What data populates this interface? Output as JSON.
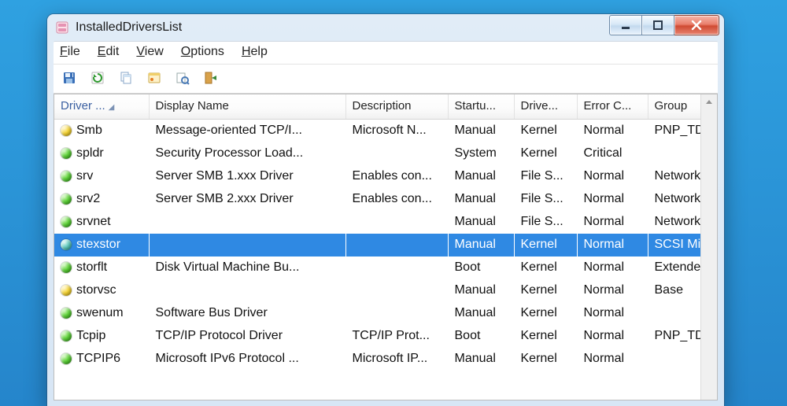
{
  "window": {
    "title": "InstalledDriversList"
  },
  "menu": {
    "file": "File",
    "edit": "Edit",
    "view": "View",
    "options": "Options",
    "help": "Help"
  },
  "toolbar": {
    "save": "save-icon",
    "refresh": "refresh-icon",
    "copy": "copy-icon",
    "properties": "properties-icon",
    "find": "find-icon",
    "exit": "exit-icon"
  },
  "columns": {
    "name": "Driver ...",
    "display": "Display Name",
    "description": "Description",
    "startup": "Startu...",
    "type": "Drive...",
    "error": "Error C...",
    "group": "Group"
  },
  "rows": [
    {
      "status": "yellow",
      "name": "Smb",
      "display": "Message-oriented TCP/I...",
      "desc": "Microsoft N...",
      "startup": "Manual",
      "type": "Kernel",
      "error": "Normal",
      "group": "PNP_TDI"
    },
    {
      "status": "green",
      "name": "spldr",
      "display": "Security Processor Load...",
      "desc": "",
      "startup": "System",
      "type": "Kernel",
      "error": "Critical",
      "group": ""
    },
    {
      "status": "green",
      "name": "srv",
      "display": "Server SMB 1.xxx Driver",
      "desc": "Enables con...",
      "startup": "Manual",
      "type": "File S...",
      "error": "Normal",
      "group": "Network"
    },
    {
      "status": "green",
      "name": "srv2",
      "display": "Server SMB 2.xxx Driver",
      "desc": "Enables con...",
      "startup": "Manual",
      "type": "File S...",
      "error": "Normal",
      "group": "Network"
    },
    {
      "status": "green",
      "name": "srvnet",
      "display": "",
      "desc": "",
      "startup": "Manual",
      "type": "File S...",
      "error": "Normal",
      "group": "Network"
    },
    {
      "status": "teal",
      "name": "stexstor",
      "display": "",
      "desc": "",
      "startup": "Manual",
      "type": "Kernel",
      "error": "Normal",
      "group": "SCSI Min",
      "selected": true
    },
    {
      "status": "green",
      "name": "storflt",
      "display": "Disk Virtual Machine Bu...",
      "desc": "",
      "startup": "Boot",
      "type": "Kernel",
      "error": "Normal",
      "group": "Extended"
    },
    {
      "status": "yellow",
      "name": "storvsc",
      "display": "",
      "desc": "",
      "startup": "Manual",
      "type": "Kernel",
      "error": "Normal",
      "group": "Base"
    },
    {
      "status": "green",
      "name": "swenum",
      "display": "Software Bus Driver",
      "desc": "",
      "startup": "Manual",
      "type": "Kernel",
      "error": "Normal",
      "group": ""
    },
    {
      "status": "green",
      "name": "Tcpip",
      "display": "TCP/IP Protocol Driver",
      "desc": "TCP/IP Prot...",
      "startup": "Boot",
      "type": "Kernel",
      "error": "Normal",
      "group": "PNP_TDI"
    },
    {
      "status": "green",
      "name": "TCPIP6",
      "display": "Microsoft IPv6 Protocol ...",
      "desc": "Microsoft IP...",
      "startup": "Manual",
      "type": "Kernel",
      "error": "Normal",
      "group": ""
    }
  ]
}
